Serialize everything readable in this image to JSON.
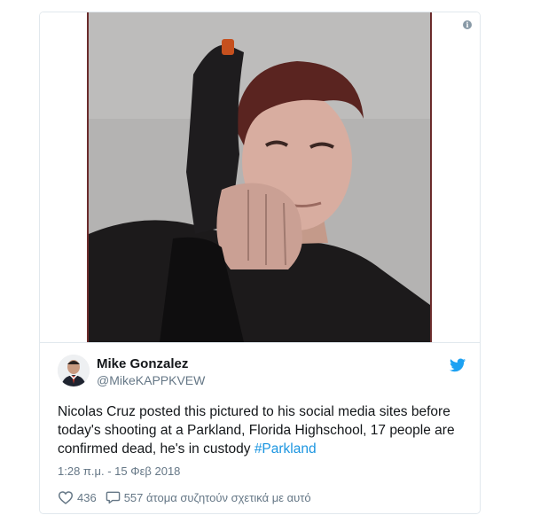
{
  "tweet": {
    "author_name": "Mike Gonzalez",
    "author_handle": "@MikeKAPPKVEW",
    "text_main": "Nicolas Cruz posted this pictured to his social media sites before today's shooting at a Parkland, Florida Highschool, 17 people are confirmed dead, he's in custody ",
    "hashtag": "#Parkland",
    "timestamp": "1:28 π.μ. - 15 Φεβ 2018",
    "likes": "436",
    "replies_text": "557 άτομα συζητούν σχετικά με αυτό"
  },
  "icons": {
    "info": "info-icon",
    "twitter": "twitter-bird-icon",
    "like": "heart-icon",
    "reply": "reply-bubble-icon"
  },
  "colors": {
    "accent": "#1b95e0",
    "text": "#14171a",
    "muted": "#657786",
    "border": "#e1e8ed"
  }
}
